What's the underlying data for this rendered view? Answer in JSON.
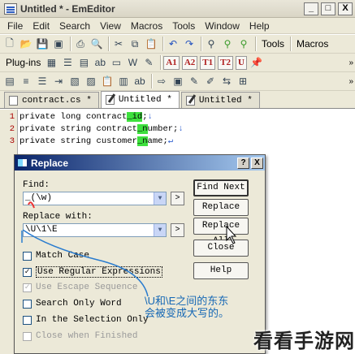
{
  "window": {
    "title": "Untitled * - EmEditor",
    "minimize": "_",
    "maximize": "□",
    "close": "X"
  },
  "menu": [
    "File",
    "Edit",
    "Search",
    "View",
    "Macros",
    "Tools",
    "Window",
    "Help"
  ],
  "toolbar1": {
    "tools_label": "Tools",
    "macros_label": "Macros"
  },
  "toolbar2": {
    "plugins_label": "Plug-ins",
    "font_buttons": [
      "A1",
      "A2",
      "T1",
      "T2",
      "U"
    ]
  },
  "tabs": [
    {
      "label": "contract.cs *"
    },
    {
      "label": "Untitled *"
    },
    {
      "label": "Untitled *"
    }
  ],
  "editor": {
    "lines": [
      {
        "no": "1",
        "pre": "private long contract",
        "hl": "_id",
        "post": ";",
        "eol": "↓"
      },
      {
        "no": "2",
        "pre": "private string contract",
        "hl": "_n",
        "post": "umber;",
        "eol": "↓"
      },
      {
        "no": "3",
        "pre": "private string customer",
        "hl": "_n",
        "post": "ame;",
        "eol": "↵"
      }
    ]
  },
  "dialog": {
    "title": "Replace",
    "help_btn": "?",
    "close_btn": "X",
    "find_label": "Find:",
    "find_value": "_(\\w)",
    "replace_label": "Replace with:",
    "replace_value": "\\U\\1\\E",
    "arrow": ">",
    "buttons": {
      "find_next": "Find Next",
      "replace": "Replace",
      "replace_all": "Replace All",
      "close": "Close",
      "help": "Help"
    },
    "options": [
      {
        "label": "Match Case",
        "checked": false,
        "disabled": false
      },
      {
        "label": "Use Regular Expressions",
        "checked": true,
        "disabled": false
      },
      {
        "label": "Use Escape Sequence",
        "checked": true,
        "disabled": true
      },
      {
        "label": "Search Only Word",
        "checked": false,
        "disabled": false
      },
      {
        "label": "In the Selection Only",
        "checked": false,
        "disabled": false
      },
      {
        "label": "Close when Finished",
        "checked": false,
        "disabled": true
      }
    ]
  },
  "annotation": {
    "line1": "\\U和\\E之间的东东",
    "line2": "会被变成大写的。"
  },
  "watermark": "看看手游网",
  "colors": {
    "highlight": "#3ee03e",
    "annotation": "#1668b5",
    "title_gradient_start": "#0a246a"
  }
}
